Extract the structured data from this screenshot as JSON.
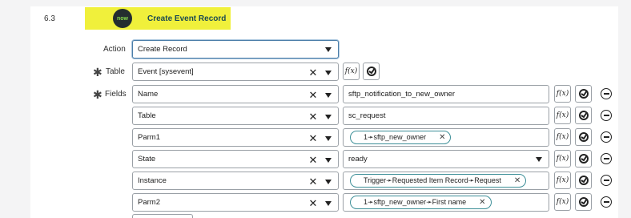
{
  "step": {
    "number": "6.3",
    "badge": "now",
    "title": "Create Event Record"
  },
  "action": {
    "label": "Action",
    "value": "Create Record"
  },
  "table": {
    "label": "Table",
    "value": "Event [sysevent]"
  },
  "fields_label": "Fields",
  "fields": [
    {
      "name": "Name",
      "value": "sftp_notification_to_new_owner",
      "pill": false
    },
    {
      "name": "Table",
      "value": "sc_request",
      "pill": false
    },
    {
      "name": "Parm1",
      "value": "1➛sftp_new_owner",
      "pill": true
    },
    {
      "name": "State",
      "value": "ready",
      "pill": false
    },
    {
      "name": "Instance",
      "value": "Trigger➛Requested Item Record➛Request",
      "pill": true
    },
    {
      "name": "Parm2",
      "value": "1➛sftp_new_owner➛First name",
      "pill": true
    }
  ],
  "icons": {
    "clear": "clear-x-icon",
    "dropdown": "chevron-down-icon",
    "function": "fx-icon",
    "data_pill_picker": "data-pill-picker-icon",
    "remove": "remove-row-icon",
    "required": "required-asterisk-icon"
  },
  "colors": {
    "highlight": "#f0f03b",
    "badge_bg": "#242d2f",
    "badge_text": "#86d94a",
    "pill_border": "#3d8f98",
    "active_border": "#4b7ea8"
  }
}
